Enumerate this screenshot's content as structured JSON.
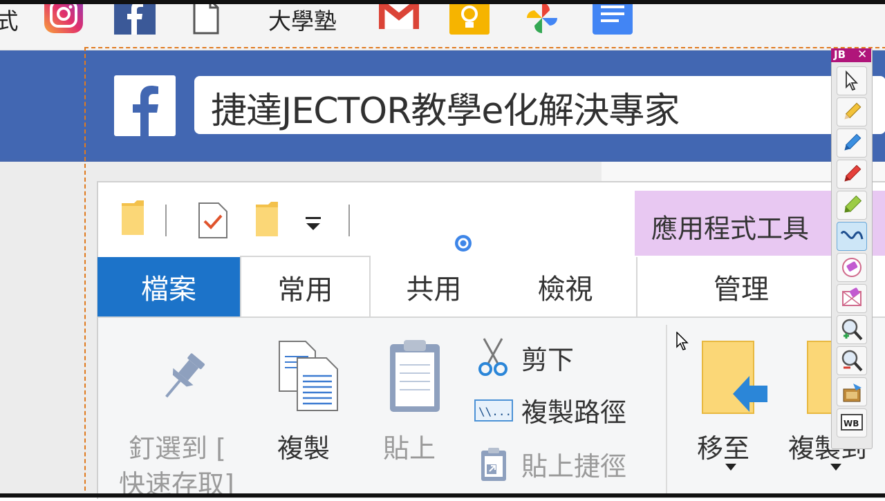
{
  "bookmarks": {
    "partial_text": "式",
    "site_text": "大學塾",
    "items": [
      "instagram-icon",
      "facebook-icon",
      "document-icon",
      "site-text",
      "gmail-icon",
      "keep-icon",
      "photos-icon",
      "docs-icon"
    ]
  },
  "header": {
    "title": "捷達JECTOR教學e化解決專家",
    "brand_color": "#4267b2"
  },
  "explorer": {
    "contextual_tab": "應用程式工具",
    "tabs": {
      "file": "檔案",
      "home": "常用",
      "share": "共用",
      "view": "檢視",
      "manage": "管理"
    },
    "ribbon": {
      "pin_label_1": "釘選到 [",
      "pin_label_2": "快速存取]",
      "copy": "複製",
      "paste": "貼上",
      "cut": "剪下",
      "copy_path": "複製路徑",
      "paste_shortcut": "貼上捷徑",
      "move_to": "移至",
      "copy_to": "複製到"
    }
  },
  "jb_toolbar": {
    "title": "JB",
    "close": "✕",
    "wb_label": "WB",
    "tools": [
      "pointer-icon",
      "pencil-yellow-icon",
      "pen-blue-icon",
      "pen-red-icon",
      "highlighter-green-icon",
      "curve-icon",
      "eraser-icon",
      "clear-icon",
      "zoom-in-icon",
      "zoom-out-icon",
      "screenshot-icon",
      "whiteboard-icon"
    ],
    "active_tool": "curve-icon"
  }
}
